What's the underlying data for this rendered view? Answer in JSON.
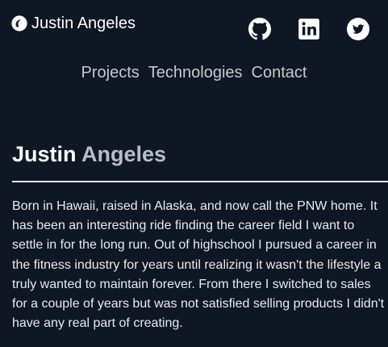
{
  "header": {
    "brand": "Justin Angeles",
    "logo_icon": "circle-swirl-icon",
    "social": [
      {
        "name": "GitHub",
        "icon": "github-icon"
      },
      {
        "name": "LinkedIn",
        "icon": "linkedin-icon"
      },
      {
        "name": "Twitter",
        "icon": "twitter-icon"
      }
    ]
  },
  "nav": {
    "items": [
      {
        "label": "Projects"
      },
      {
        "label": "Technologies"
      },
      {
        "label": "Contact"
      }
    ]
  },
  "hero": {
    "first_name": "Justin",
    "last_name": "Angeles",
    "bio": "Born in Hawaii, raised in Alaska, and now call the PNW home. It has been an interesting ride finding the career field I want to settle in for the long run. Out of highschool I pursued a career in the fitness industry for years until realizing it wasn't the lifestyle a truly wanted to maintain forever. From there I switched to sales for a couple of years but was not satisfied selling products I didn't have any real part of creating."
  },
  "colors": {
    "background": "#0f1624",
    "text": "#ffffff",
    "nav_text": "#c6c9cf",
    "accent_gray": "#b8bcc4"
  }
}
